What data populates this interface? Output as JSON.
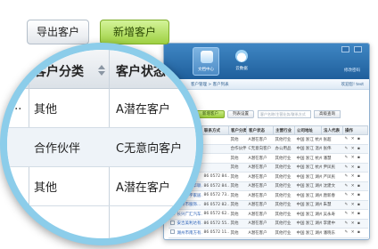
{
  "toolbar": {
    "export_label": "导出客户",
    "new_label": "新增客户"
  },
  "window": {
    "nav": [
      {
        "label": "文档中心",
        "icon": "customer-center-icon"
      },
      {
        "label": "云数据",
        "icon": "cloud-data-icon"
      }
    ],
    "extra_link": "修改密码",
    "breadcrumb": "客户管理 > 客户列表",
    "welcome": "欢迎您! test",
    "buttons": {
      "new": "新增客户",
      "list_setting": "列表设置",
      "search_placeholder": "客户名称/主营业务/联系方式",
      "search": "高级查询"
    },
    "columns": [
      "",
      "客户名称",
      "联系方式",
      "客户分类",
      "客户状态",
      "主营行业",
      "公司地址",
      "法人代表",
      "操作"
    ],
    "rows": [
      [
        "",
        "",
        "",
        "其他",
        "A潜在客户",
        "其他行业",
        "中国 浙江 杭州",
        "张超",
        "✎ ✕ ▪"
      ],
      [
        "",
        "",
        "",
        "合作伙伴",
        "C无意向客户",
        "办公用品",
        "中国 浙江 温州",
        "张伟",
        "✎ ✕ ▪"
      ],
      [
        "",
        "",
        "",
        "其他",
        "A潜在客户",
        "其他行业",
        "中国 浙江 杭州",
        "潘慧",
        "✎ ✕ ▪"
      ],
      [
        "",
        "",
        "",
        "其他",
        "A潜在客户",
        "其他行业",
        "中国 浙江 杭州",
        "尹凤民",
        "✎ ✕ ▪"
      ],
      [
        "",
        "",
        "86 0572 84...",
        "其他",
        "A潜在客户",
        "其他行业",
        "中国 浙江 湖州",
        "严凤民",
        "✎ ✕ ▪"
      ],
      [
        "",
        "通通美新华联...",
        "86 0572 84...",
        "其他",
        "A潜在客户",
        "其他行业",
        "中国 浙江 湖州",
        "沈建文",
        "✎ ✕ ▪"
      ],
      [
        "",
        "湖州广宇家居...",
        "86 0572 73...",
        "其他",
        "A潜在客户",
        "其他行业",
        "中国 浙江 湖州",
        "唐新春",
        "✎ ✕ ▪"
      ],
      [
        "",
        "湖州市服饰...",
        "86 0572 82...",
        "其他",
        "A潜在客户",
        "其他行业",
        "中国 浙江 湖州",
        "朱慧",
        "✎ ✕ ▪"
      ],
      [
        "",
        "长兴广汇汽车...",
        "86 0572 62...",
        "其他",
        "A潜在客户",
        "其他行业",
        "中国 浙江 湖州",
        "吴永寿",
        "✎ ✕ ▪"
      ],
      [
        "",
        "安吉美利达有...",
        "86 0572 55...",
        "其他",
        "A潜在客户",
        "其他行业",
        "中国 浙江 湖州",
        "李建中",
        "✎ ✕ ▪"
      ],
      [
        "",
        "湖州市南方有...",
        "86 0572 11...",
        "其他",
        "A潜在客户",
        "其他行业",
        "中国 浙江 湖州",
        "潘晓东",
        "✎ ✕ ▪"
      ],
      [
        "",
        "安吉县湖宇...",
        "86 0572 84...",
        "其他",
        "A潜在客户",
        "其他行业",
        "中国 浙江 湖州",
        "张开",
        "✎ ✕ ▪"
      ]
    ]
  },
  "magnifier": {
    "headers": [
      "客户分类",
      "客户状态"
    ],
    "rows": [
      [
        "其他",
        "A潜在客户"
      ],
      [
        "合作伙伴",
        "C无意向客户"
      ],
      [
        "其他",
        "A潜在客户"
      ]
    ]
  },
  "colors": {
    "accent_green": "#9fd043",
    "ring": "#8ccdea",
    "header_blue": "#1f5f9c",
    "link_blue": "#2e63b8"
  }
}
